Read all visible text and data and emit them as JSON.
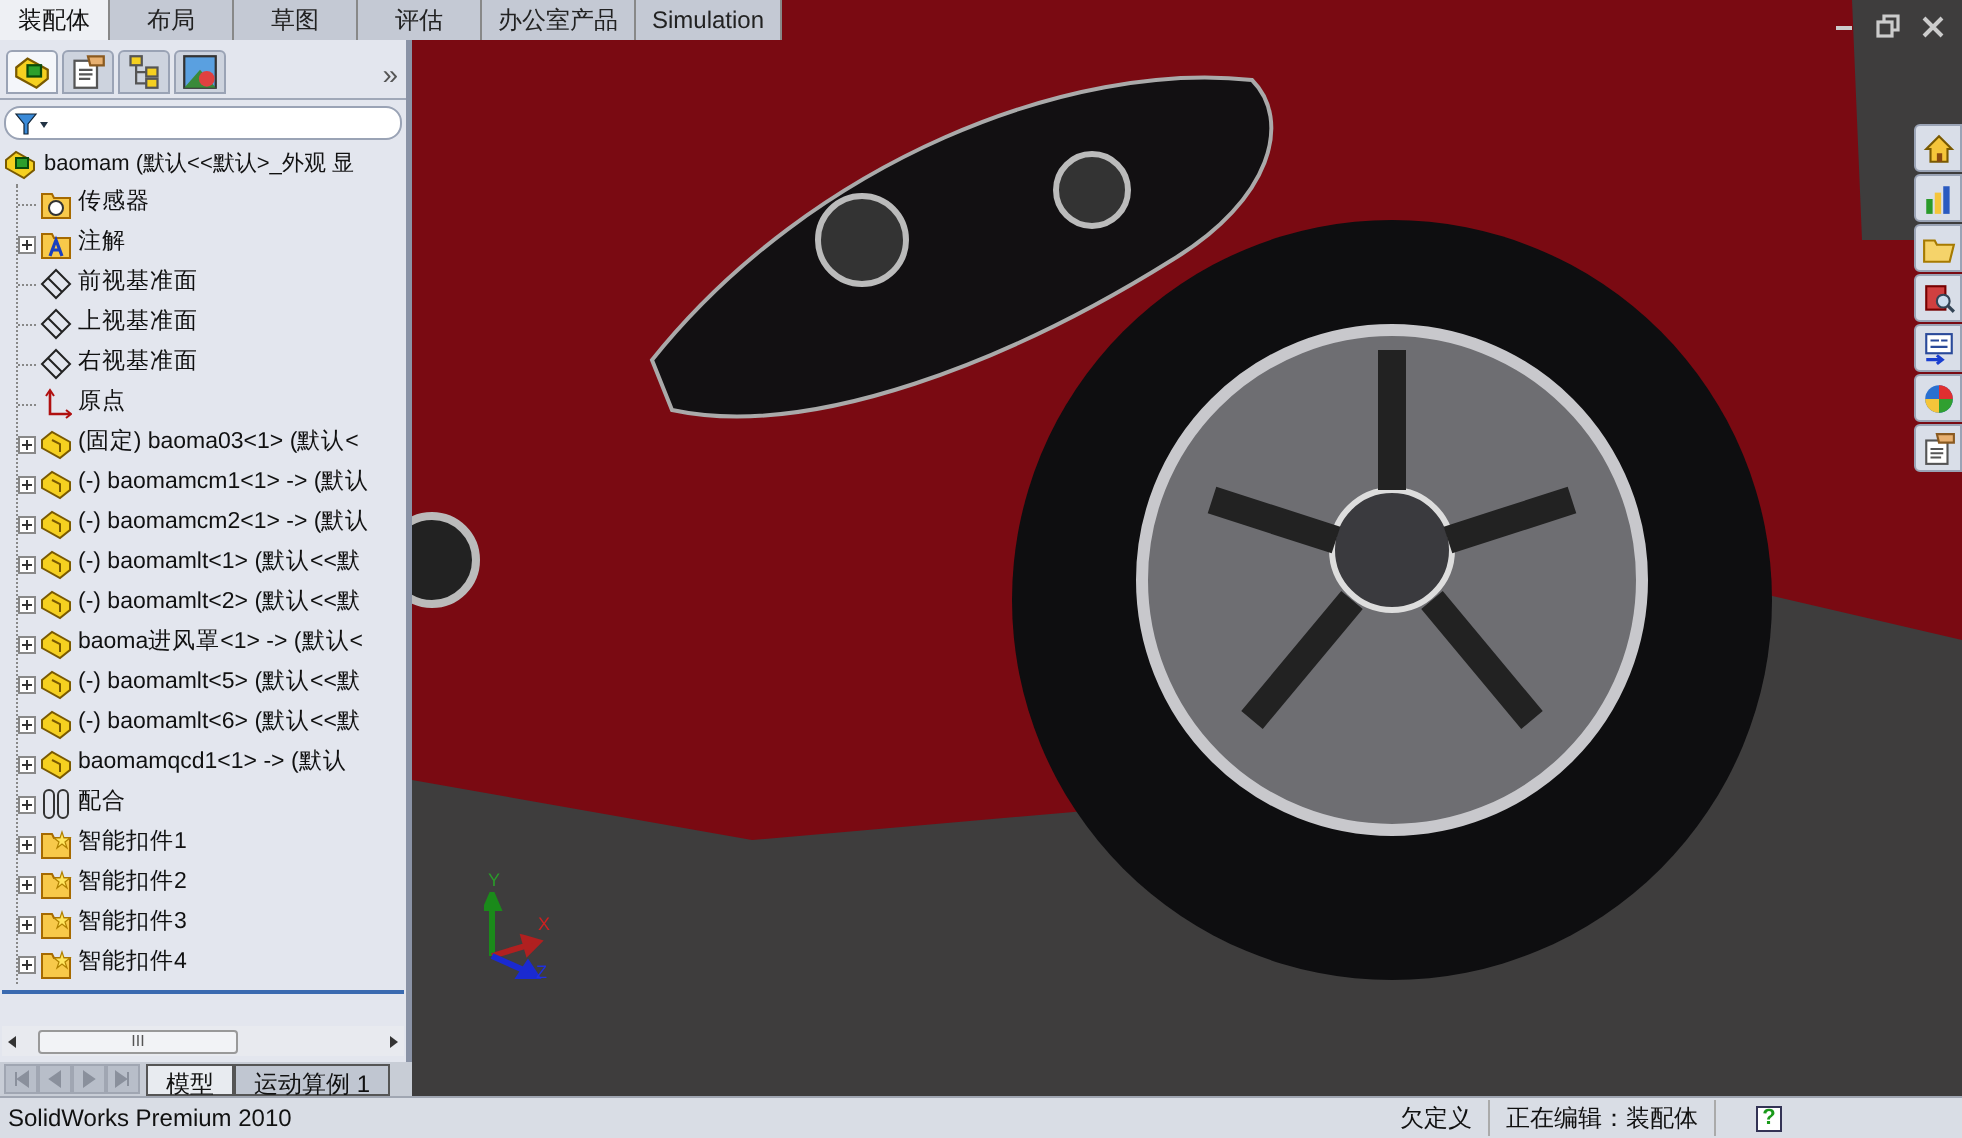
{
  "top_tabs": [
    {
      "label": "装配体",
      "selected": true
    },
    {
      "label": "布局",
      "selected": false
    },
    {
      "label": "草图",
      "selected": false
    },
    {
      "label": "评估",
      "selected": false
    },
    {
      "label": "办公室产品",
      "selected": false
    },
    {
      "label": "Simulation",
      "selected": false
    }
  ],
  "panel_tabs": [
    {
      "kind": "feature",
      "selected": true
    },
    {
      "kind": "property",
      "selected": false
    },
    {
      "kind": "config",
      "selected": false
    },
    {
      "kind": "display",
      "selected": false
    }
  ],
  "panel_more": "»",
  "tree": {
    "text": "baomam  (默认<<默认>_外观 显",
    "kind": "assembly",
    "children": [
      {
        "text": "传感器",
        "kind": "sensor",
        "expandable": false
      },
      {
        "text": "注解",
        "kind": "annotation",
        "expandable": true
      },
      {
        "text": "前视基准面",
        "kind": "plane",
        "expandable": false
      },
      {
        "text": "上视基准面",
        "kind": "plane",
        "expandable": false
      },
      {
        "text": "右视基准面",
        "kind": "plane",
        "expandable": false
      },
      {
        "text": "原点",
        "kind": "origin",
        "expandable": false
      },
      {
        "text": "(固定) baoma03<1> (默认<",
        "kind": "part",
        "expandable": true
      },
      {
        "text": "(-) baomamcm1<1> -> (默认",
        "kind": "part",
        "expandable": true
      },
      {
        "text": "(-) baomamcm2<1> -> (默认",
        "kind": "part",
        "expandable": true
      },
      {
        "text": "(-) baomamlt<1> (默认<<默",
        "kind": "part",
        "expandable": true
      },
      {
        "text": "(-) baomamlt<2> (默认<<默",
        "kind": "part",
        "expandable": true
      },
      {
        "text": "baoma进风罩<1> -> (默认<",
        "kind": "part",
        "expandable": true
      },
      {
        "text": "(-) baomamlt<5> (默认<<默",
        "kind": "part",
        "expandable": true
      },
      {
        "text": "(-) baomamlt<6> (默认<<默",
        "kind": "part",
        "expandable": true
      },
      {
        "text": "baomamqcd1<1> -> (默认",
        "kind": "part",
        "expandable": true
      },
      {
        "text": "配合",
        "kind": "mates",
        "expandable": true
      },
      {
        "text": "智能扣件1",
        "kind": "fastener",
        "expandable": true
      },
      {
        "text": "智能扣件2",
        "kind": "fastener",
        "expandable": true
      },
      {
        "text": "智能扣件3",
        "kind": "fastener",
        "expandable": true
      },
      {
        "text": "智能扣件4",
        "kind": "fastener",
        "expandable": true
      }
    ]
  },
  "scroll_grip": "III",
  "bottom_tabs": [
    {
      "label": "模型",
      "selected": true
    },
    {
      "label": "运动算例 1",
      "selected": false
    }
  ],
  "triad": {
    "x": "X",
    "y": "Y",
    "z": "Z"
  },
  "status_bar": {
    "product": "SolidWorks Premium 2010",
    "state": "欠定义",
    "editing": "正在编辑：装配体",
    "help": "?"
  }
}
